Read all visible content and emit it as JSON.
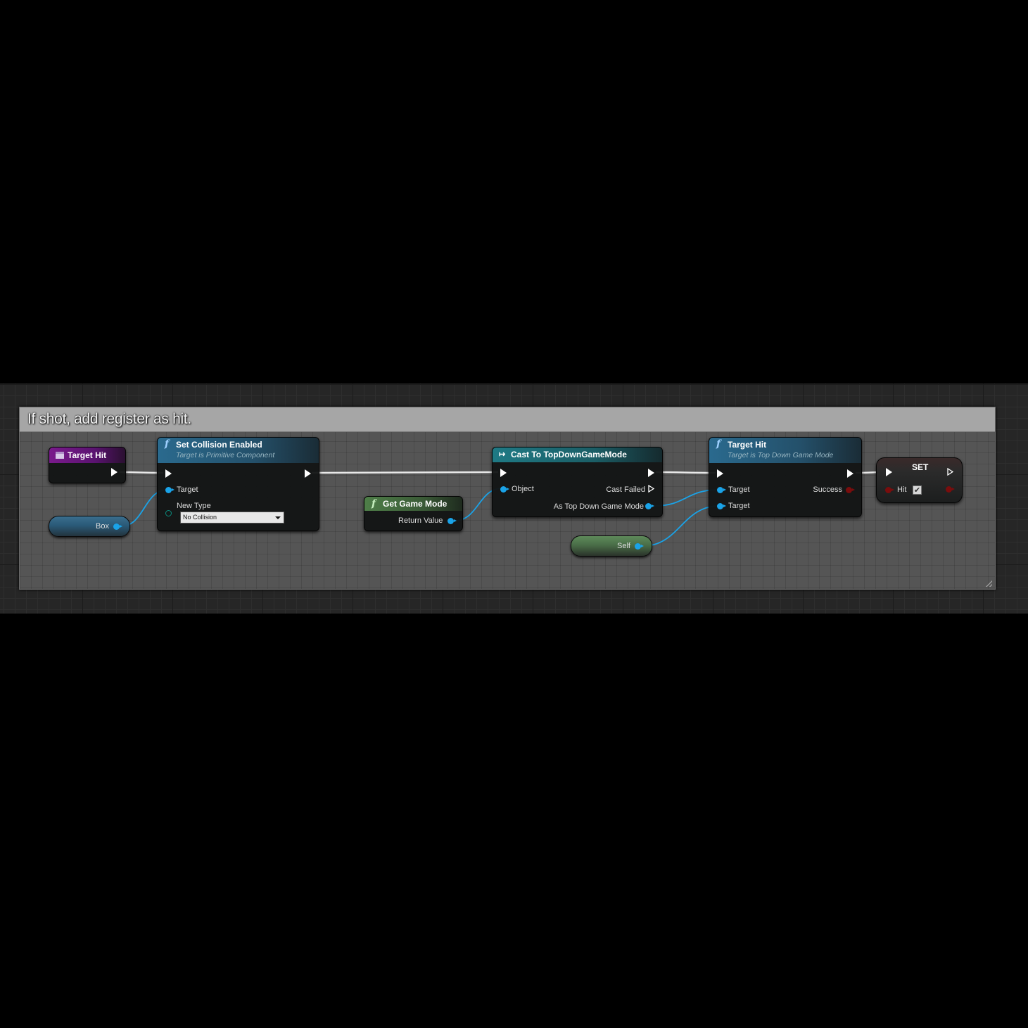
{
  "comment": {
    "title": "If shot, add register as hit."
  },
  "nodes": {
    "event_target_hit": {
      "title": "Target Hit"
    },
    "set_collision": {
      "title": "Set Collision Enabled",
      "subtitle": "Target is Primitive Component",
      "pins": {
        "target": "Target",
        "new_type": "New Type"
      },
      "new_type_value": "No Collision"
    },
    "box_var": {
      "label": "Box"
    },
    "get_game_mode": {
      "title": "Get Game Mode",
      "return_value": "Return Value"
    },
    "cast": {
      "title": "Cast To TopDownGameMode",
      "object": "Object",
      "cast_failed": "Cast Failed",
      "as_output": "As Top Down Game Mode"
    },
    "target_hit_fn": {
      "title": "Target Hit",
      "subtitle": "Target is Top Down Game Mode",
      "target1": "Target",
      "target2": "Target",
      "success": "Success"
    },
    "self_var": {
      "label": "Self"
    },
    "set_node": {
      "title": "SET",
      "hit_label": "Hit",
      "hit_checked": true
    }
  },
  "colors": {
    "exec_wire": "#ffffff",
    "object_pin": "#1aa3e8",
    "bool_pin": "#7a0d0d",
    "event_header": "#7a1a8c",
    "function_header": "#2a5c7a",
    "pure_header": "#3f6a3a",
    "cast_header": "#1d6f79"
  },
  "icons": {
    "event": "event-icon",
    "function": "function-icon",
    "cast": "cast-arrow-icon",
    "dropdown": "chevron-down-icon",
    "checkbox": "checkbox-icon"
  }
}
